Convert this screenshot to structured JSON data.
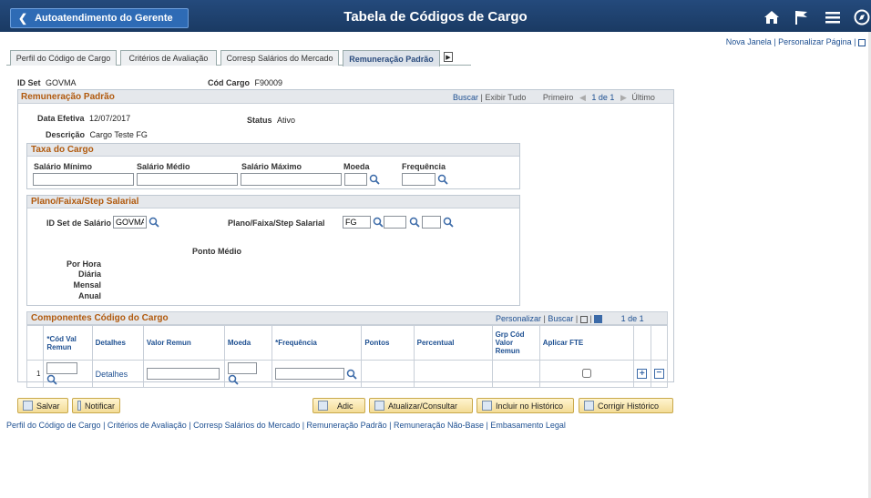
{
  "header": {
    "back_label": "Autoatendimento do Gerente",
    "title": "Tabela de Códigos de Cargo"
  },
  "toplinks": {
    "new_window": "Nova Janela",
    "personalize": "Personalizar Página"
  },
  "tabs": [
    {
      "label": "Perfil do Código de Cargo"
    },
    {
      "label": "Critérios de Avaliação"
    },
    {
      "label": "Corresp Salários do Mercado"
    },
    {
      "label": "Remuneração Padrão"
    }
  ],
  "ids": {
    "setid_label": "ID Set",
    "setid_value": "GOVMA",
    "jobcode_label": "Cód Cargo",
    "jobcode_value": "F90009"
  },
  "main_section": {
    "title": "Remuneração Padrão",
    "nav_find": "Buscar",
    "nav_viewall": "Exibir Tudo",
    "nav_first": "Primeiro",
    "nav_count": "1 de 1",
    "nav_last": "Último",
    "eff_date_label": "Data Efetiva",
    "eff_date_value": "12/07/2017",
    "status_label": "Status",
    "status_value": "Ativo",
    "descr_label": "Descrição",
    "descr_value": "Cargo Teste FG"
  },
  "job_rate": {
    "title": "Taxa do Cargo",
    "min_label": "Salário Mínimo",
    "mid_label": "Salário Médio",
    "max_label": "Salário Máximo",
    "currency_label": "Moeda",
    "frequency_label": "Frequência"
  },
  "plan": {
    "title": "Plano/Faixa/Step Salarial",
    "setid_label": "ID Set de Salário",
    "setid_value": "GOVMA",
    "pgs_label": "Plano/Faixa/Step Salarial",
    "plan_value": "FG",
    "midpoint_label": "Ponto Médio",
    "hourly": "Por Hora",
    "daily": "Diária",
    "monthly": "Mensal",
    "annual": "Anual"
  },
  "components": {
    "title": "Componentes Código do Cargo",
    "personalize": "Personalizar",
    "find": "Buscar",
    "count": "1 de 1",
    "columns": [
      "*Cód Val Remun",
      "Detalhes",
      "Valor Remun",
      "Moeda",
      "*Frequência",
      "Pontos",
      "Percentual",
      "Grp Cód Valor Remun",
      "Aplicar FTE"
    ],
    "row_num": "1",
    "details_link": "Detalhes"
  },
  "buttons": {
    "save": "Salvar",
    "notify": "Notificar",
    "add": "Adic",
    "update": "Atualizar/Consultar",
    "include_history": "Incluir no Histórico",
    "correct_history": "Corrigir Histórico"
  },
  "footer_links": [
    "Perfil do Código de Cargo",
    "Critérios de Avaliação",
    "Corresp Salários do Mercado",
    "Remuneração Padrão",
    "Remuneração Não-Base",
    "Embasamento Legal"
  ],
  "colors": {
    "header_bg": "#1a3a63",
    "section_title": "#b15a0e",
    "link": "#1d4f91"
  }
}
